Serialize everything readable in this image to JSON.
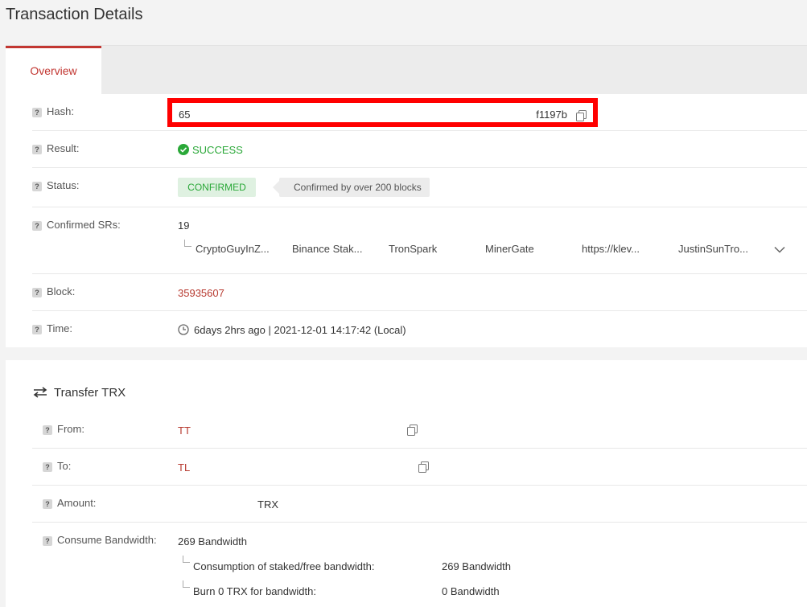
{
  "header": {
    "title": "Transaction Details"
  },
  "tabs": [
    {
      "label": "Overview"
    }
  ],
  "overview": {
    "hash": {
      "label": "Hash:",
      "value_start": "65",
      "value_end": "f1197b"
    },
    "result": {
      "label": "Result:",
      "value": "SUCCESS"
    },
    "status": {
      "label": "Status:",
      "badge": "CONFIRMED",
      "tip": "Confirmed by over 200 blocks"
    },
    "confirmed_srs": {
      "label": "Confirmed SRs:",
      "count": "19",
      "items": [
        "CryptoGuyInZ...",
        "Binance Stak...",
        "TronSpark",
        "MinerGate",
        "https://klev...",
        "JustinSunTro..."
      ]
    },
    "block": {
      "label": "Block:",
      "value": "35935607"
    },
    "time": {
      "label": "Time:",
      "value": "6days 2hrs ago | 2021-12-01 14:17:42 (Local)"
    }
  },
  "transfer": {
    "title": "Transfer TRX",
    "from": {
      "label": "From:",
      "value": "TT"
    },
    "to": {
      "label": "To:",
      "value": "TL"
    },
    "amount": {
      "label": "Amount:",
      "unit": "TRX"
    },
    "bandwidth": {
      "label": "Consume Bandwidth:",
      "value": "269 Bandwidth",
      "details": [
        {
          "label": "Consumption of staked/free bandwidth:",
          "value": "269 Bandwidth"
        },
        {
          "label": "Burn 0 TRX for bandwidth:",
          "value": "0 Bandwidth"
        }
      ]
    }
  },
  "colors": {
    "accent": "#c23631",
    "success": "#2aa838",
    "highlight": "#ff0000"
  }
}
